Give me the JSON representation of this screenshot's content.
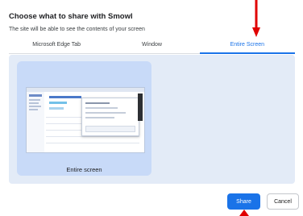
{
  "dialog": {
    "title": "Choose what to share with Smowl",
    "subtitle": "The site will be able to see the contents of your screen"
  },
  "tabs": [
    {
      "label": "Microsoft Edge Tab",
      "active": false
    },
    {
      "label": "Window",
      "active": false
    },
    {
      "label": "Entire Screen",
      "active": true
    }
  ],
  "sources": [
    {
      "label": "Entire screen",
      "selected": true
    }
  ],
  "buttons": {
    "share": "Share",
    "cancel": "Cancel"
  },
  "colors": {
    "accent": "#1a73e8",
    "annotation_arrow": "#e00000",
    "panel_bg": "#e3ebf7",
    "selected_card": "#c8daf8"
  },
  "annotations": [
    {
      "type": "arrow-down",
      "target": "tab-entire-screen"
    },
    {
      "type": "arrow-up",
      "target": "share-button"
    }
  ]
}
